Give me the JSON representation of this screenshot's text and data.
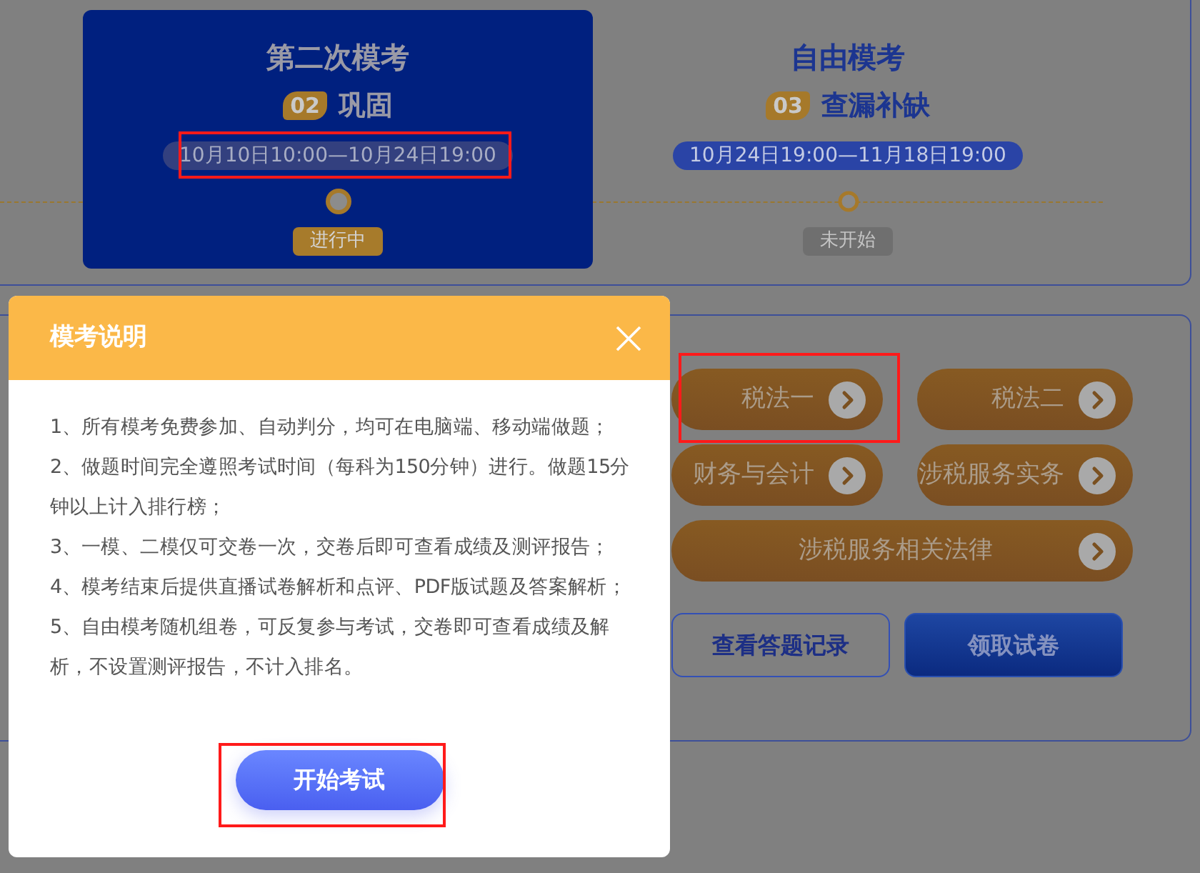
{
  "stages": [
    {
      "title": "第二次模考",
      "number": "02",
      "subtitle": "巩固",
      "period": "10月10日10:00—10月24日19:00",
      "status": "进行中",
      "selected": true
    },
    {
      "title": "自由模考",
      "number": "03",
      "subtitle": "查漏补缺",
      "period": "10月24日19:00—11月18日19:00",
      "status": "未开始",
      "selected": false
    }
  ],
  "subjects": [
    {
      "label": "税法一"
    },
    {
      "label": "税法二"
    },
    {
      "label": "财务与会计"
    },
    {
      "label": "涉税服务实务"
    },
    {
      "label": "涉税服务相关法律"
    }
  ],
  "actions": [
    {
      "label": "查看答题记录",
      "kind": "outline"
    },
    {
      "label": "领取试卷",
      "kind": "filled"
    }
  ],
  "dialog": {
    "title": "模考说明",
    "paragraphs": [
      "1、所有模考免费参加、自动判分，均可在电脑端、移动端做题；",
      "2、做题时间完全遵照考试时间（每科为150分钟）进行。做题15分钟以上计入排行榜；",
      "3、一模、二模仅可交卷一次，交卷后即可查看成绩及测评报告；",
      "4、模考结束后提供直播试卷解析和点评、PDF版试题及答案解析；",
      "5、自由模考随机组卷，可反复参与考试，交卷即可查看成绩及解析，不设置测评报告，不计入排名。"
    ],
    "button": "开始考试"
  }
}
